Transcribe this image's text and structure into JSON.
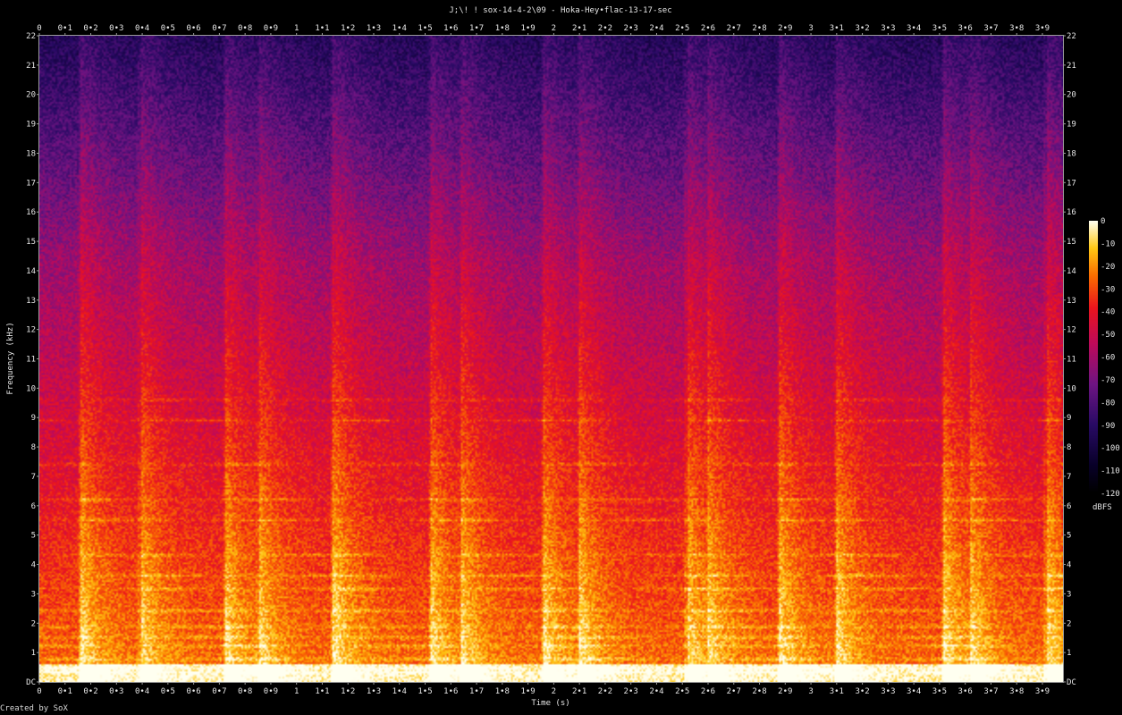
{
  "chart_data": {
    "type": "heatmap",
    "title": "J;\\! ! sox-14-4-2\\09 - Hoka-Hey•flac-13-17-sec",
    "xlabel": "Time (s)",
    "ylabel": "Frequency (kHz)",
    "xlim": [
      0,
      3.98
    ],
    "ylim": [
      0,
      22
    ],
    "x_ticks": [
      "0",
      "0•1",
      "0•2",
      "0•3",
      "0•4",
      "0•5",
      "0•6",
      "0•7",
      "0•8",
      "0•9",
      "1",
      "1•1",
      "1•2",
      "1•3",
      "1•4",
      "1•5",
      "1•6",
      "1•7",
      "1•8",
      "1•9",
      "2",
      "2•1",
      "2•2",
      "2•3",
      "2•4",
      "2•5",
      "2•6",
      "2•7",
      "2•8",
      "2•9",
      "3",
      "3•1",
      "3•2",
      "3•3",
      "3•4",
      "3•5",
      "3•6",
      "3•7",
      "3•8",
      "3•9"
    ],
    "y_ticks": [
      "DC",
      "1",
      "2",
      "3",
      "4",
      "5",
      "6",
      "7",
      "8",
      "9",
      "10",
      "11",
      "12",
      "13",
      "14",
      "15",
      "16",
      "17",
      "18",
      "19",
      "20",
      "21",
      "22"
    ],
    "colorbar": {
      "label": "dBFS",
      "ticks": [
        "0",
        "-10",
        "-20",
        "-30",
        "-40",
        "-50",
        "-60",
        "-70",
        "-80",
        "-90",
        "-100",
        "-110",
        "-120"
      ],
      "range": [
        -120,
        0
      ]
    },
    "onsets_s": [
      0.16,
      0.39,
      0.72,
      0.85,
      1.14,
      1.15,
      1.52,
      1.64,
      1.96,
      2.1,
      2.52,
      2.6,
      2.88,
      3.1,
      3.52,
      3.62,
      3.92
    ],
    "tonal_bands_khz": [
      0.3,
      0.45,
      0.75,
      1.2,
      1.5,
      1.85,
      2.4,
      3.15,
      3.6,
      4.3,
      5.5,
      6.2,
      7.4,
      8.9,
      9.6
    ]
  },
  "footer": "Created by SoX"
}
